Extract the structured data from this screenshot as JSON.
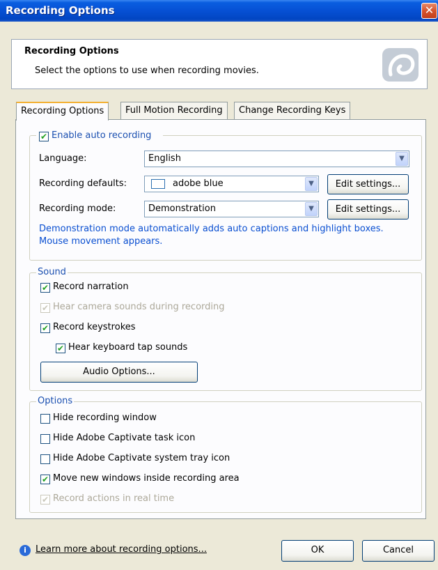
{
  "window": {
    "title": "Recording Options",
    "close_glyph": "✕"
  },
  "header": {
    "title": "Recording Options",
    "subtitle": "Select the options to use when recording movies."
  },
  "tabs": [
    {
      "label": "Recording Options"
    },
    {
      "label": "Full Motion Recording"
    },
    {
      "label": "Change Recording Keys"
    }
  ],
  "auto": {
    "enable_label": "Enable auto recording",
    "language_label": "Language:",
    "language_value": "English",
    "defaults_label": "Recording defaults:",
    "defaults_value": "adobe blue",
    "mode_label": "Recording mode:",
    "mode_value": "Demonstration",
    "edit1_label": "Edit settings...",
    "edit2_label": "Edit settings...",
    "info": "Demonstration mode automatically adds auto captions and highlight boxes. Mouse movement appears."
  },
  "sound": {
    "legend": "Sound",
    "narration": "Record narration",
    "camera": "Hear camera sounds during recording",
    "keystrokes": "Record keystrokes",
    "tap": "Hear keyboard tap sounds",
    "audio_button": "Audio Options..."
  },
  "options": {
    "legend": "Options",
    "hide_window": "Hide recording window",
    "hide_task": "Hide Adobe Captivate task icon",
    "hide_tray": "Hide Adobe Captivate system tray icon",
    "move_windows": "Move new windows inside recording area",
    "real_time": "Record actions in real time"
  },
  "footer": {
    "link": "Learn more about recording options...",
    "ok": "OK",
    "cancel": "Cancel"
  },
  "glyphs": {
    "check": "✔",
    "arrow": "▼",
    "info": "i"
  },
  "colors": {
    "accent": "#0a4fd1",
    "title_bar": "#0650d4"
  }
}
